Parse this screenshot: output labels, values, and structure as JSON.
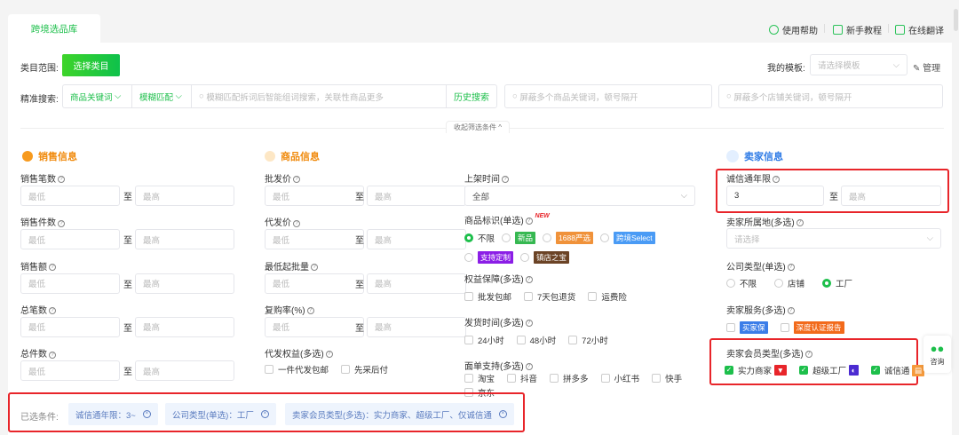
{
  "tab": "跨境选品库",
  "top_links": [
    "使用帮助",
    "新手教程",
    "在线翻译"
  ],
  "category": {
    "label": "类目范围:",
    "button": "选择类目"
  },
  "template": {
    "label": "我的模板:",
    "placeholder": "请选择模板",
    "manage": "管理"
  },
  "search": {
    "label": "精准搜索:",
    "field": "商品关键词",
    "match": "模糊匹配",
    "placeholder": "模糊匹配拆词后智能组词搜索，关联性商品更多",
    "history": "历史搜索",
    "block_product": "屏蔽多个商品关键词，顿号隔开",
    "block_shop": "屏蔽多个店铺关键词，顿号隔开"
  },
  "collapse": "收起筛选条件",
  "placeholders": {
    "min": "最低",
    "max": "最高",
    "to": "至",
    "select": "请选择"
  },
  "sales": {
    "title": "销售信息",
    "fields": [
      "销售笔数",
      "销售件数",
      "销售额",
      "总笔数",
      "总件数"
    ]
  },
  "product": {
    "title": "商品信息",
    "fields": [
      "批发价",
      "代发价",
      "最低起批量",
      "复购率(%)"
    ],
    "dropship": {
      "label": "代发权益(多选)",
      "options": [
        "一件代发包邮",
        "先采后付"
      ]
    },
    "listing": {
      "label": "上架时间",
      "value": "全部"
    },
    "mark": {
      "label": "商品标识(单选)",
      "new": "NEW",
      "options": [
        "不限",
        "新品",
        "1688严选",
        "跨境Select",
        "支持定制",
        "镇店之宝"
      ]
    },
    "guarantee": {
      "label": "权益保障(多选)",
      "options": [
        "批发包邮",
        "7天包退货",
        "运费险"
      ]
    },
    "ship": {
      "label": "发货时间(多选)",
      "options": [
        "24小时",
        "48小时",
        "72小时"
      ]
    },
    "waybill": {
      "label": "面单支持(多选)",
      "options": [
        "淘宝",
        "抖音",
        "拼多多",
        "小红书",
        "快手",
        "京东"
      ]
    }
  },
  "seller": {
    "title": "卖家信息",
    "years": {
      "label": "诚信通年限",
      "min": "3"
    },
    "location": {
      "label": "卖家所属地(多选)"
    },
    "company": {
      "label": "公司类型(单选)",
      "options": [
        "不限",
        "店铺",
        "工厂"
      ]
    },
    "service": {
      "label": "卖家服务(多选)",
      "options": [
        "买家保",
        "深度认证报告"
      ]
    },
    "member": {
      "label": "卖家会员类型(多选)",
      "options": [
        "实力商家",
        "超级工厂",
        "诚信通"
      ]
    }
  },
  "consult": "咨询",
  "selected": {
    "label": "已选条件:",
    "tags": [
      "诚信通年限：3~",
      "公司类型(单选)：工厂",
      "卖家会员类型(多选)：实力商家、超级工厂、仅诚信通"
    ]
  }
}
